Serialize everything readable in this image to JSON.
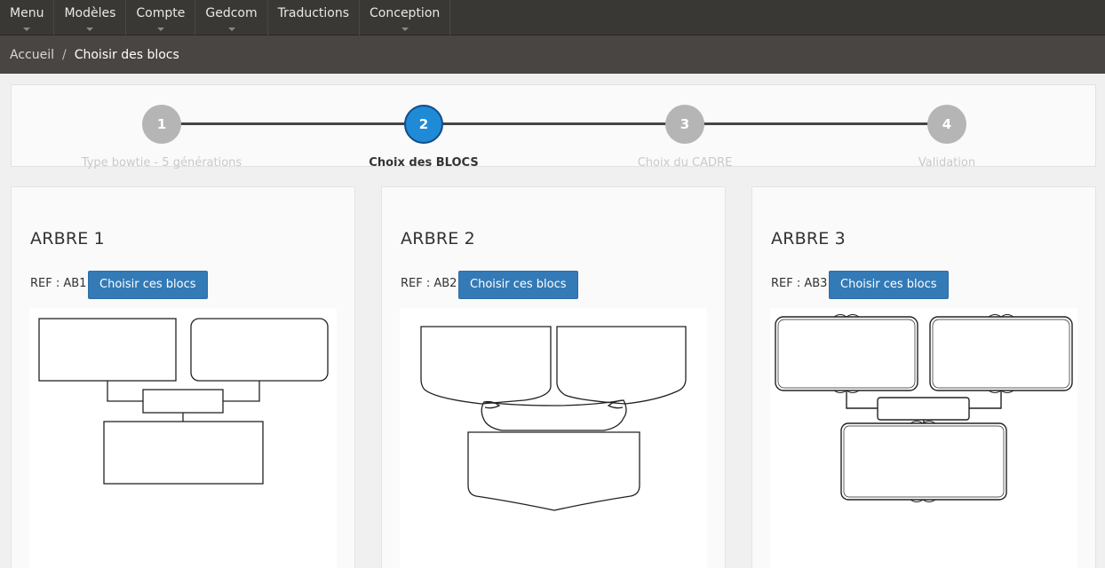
{
  "nav": {
    "items": [
      {
        "label": "Menu",
        "dropdown": true
      },
      {
        "label": "Modèles",
        "dropdown": true
      },
      {
        "label": "Compte",
        "dropdown": true
      },
      {
        "label": "Gedcom",
        "dropdown": true
      },
      {
        "label": "Traductions",
        "dropdown": false
      },
      {
        "label": "Conception",
        "dropdown": true
      }
    ]
  },
  "breadcrumb": {
    "home": "Accueil",
    "separator": "/",
    "current": "Choisir des blocs"
  },
  "stepper": {
    "steps": [
      {
        "number": "1",
        "label": "Type bowtie - 5 générations",
        "state": "done"
      },
      {
        "number": "2",
        "label": "Choix des BLOCS",
        "state": "active"
      },
      {
        "number": "3",
        "label": "Choix du CADRE",
        "state": "todo"
      },
      {
        "number": "4",
        "label": "Validation",
        "state": "todo"
      }
    ]
  },
  "trees": [
    {
      "title": "ARBRE 1",
      "ref": "REF : AB1",
      "button": "Choisir ces blocs",
      "style": "plain-rect"
    },
    {
      "title": "ARBRE 2",
      "ref": "REF : AB2",
      "button": "Choisir ces blocs",
      "style": "shield-scroll"
    },
    {
      "title": "ARBRE 3",
      "ref": "REF : AB3",
      "button": "Choisir ces blocs",
      "style": "ornate-frame"
    }
  ],
  "colors": {
    "nav_bg": "#3a3835",
    "breadcrumb_bg": "#484542",
    "active_step": "#1f8bd6",
    "inactive_step": "#b5b5b5",
    "button": "#337ab7"
  }
}
